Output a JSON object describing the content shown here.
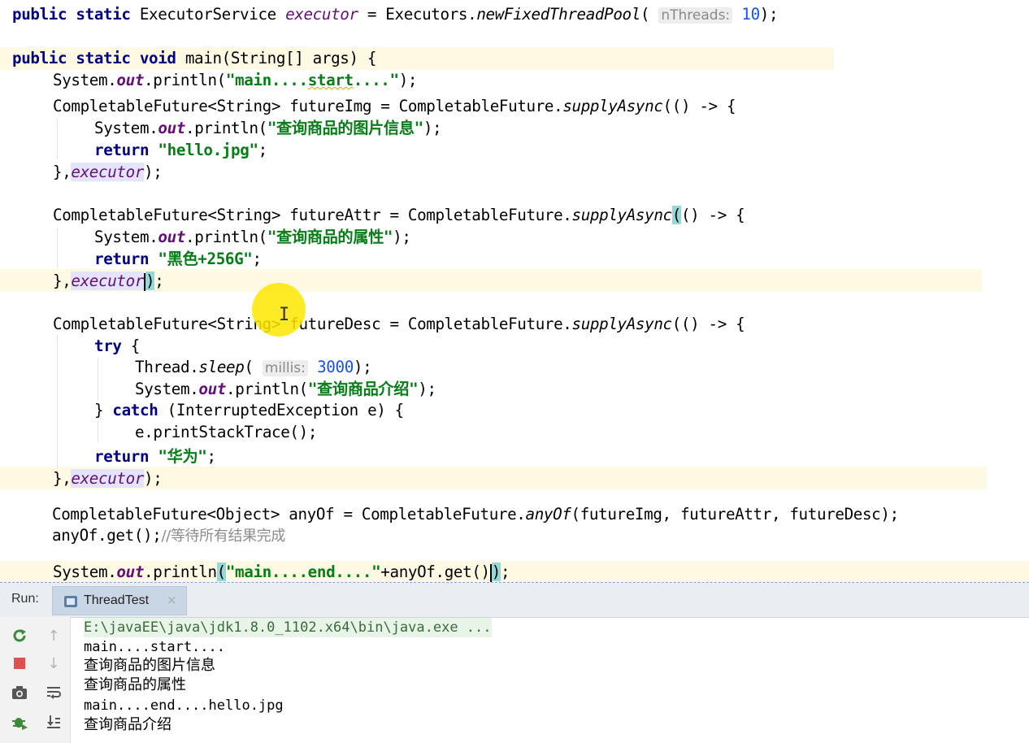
{
  "editor": {
    "line1": {
      "kw": "public static",
      "type": " ExecutorService ",
      "field": "executor",
      "eq": " = Executors.",
      "method": "newFixedThreadPool",
      "open": "( ",
      "hint": "nThreads:",
      "num": " 10",
      "close": ");"
    },
    "line_main": {
      "kw": "public static void",
      "rest": " main(String[] args) {"
    },
    "line_start": {
      "pre": "System.",
      "out": "out",
      "mid": ".println(",
      "str_open": "\"main....",
      "str_sq": "start",
      "str_close": "....\"",
      "close": ");"
    },
    "img_decl": {
      "pre": "CompletableFuture<String> futureImg = CompletableFuture.",
      "method": "supplyAsync",
      "post": "(() -> {"
    },
    "img_print": {
      "pre": "System.",
      "out": "out",
      "mid": ".println(",
      "str": "\"查询商品的图片信息\"",
      "close": ");"
    },
    "img_return": {
      "kw": "return",
      "str": " \"hello.jpg\"",
      "semi": ";"
    },
    "img_close": {
      "pre": "},",
      "field": "executor",
      "close": ");"
    },
    "attr_decl": {
      "pre": "CompletableFuture<String> futureAttr = CompletableFuture.",
      "method": "supplyAsync",
      "paren": "(",
      "post": "() -> {"
    },
    "attr_print": {
      "pre": "System.",
      "out": "out",
      "mid": ".println(",
      "str": "\"查询商品的属性\"",
      "close": ");"
    },
    "attr_return": {
      "kw": "return",
      "str": " \"黑色+256G\"",
      "semi": ";"
    },
    "attr_close": {
      "pre": "},",
      "field": "executo",
      "field2": "r",
      "paren": ")",
      "close": ";"
    },
    "desc_decl": {
      "pre": "CompletableFuture<String> futureDesc = CompletableFuture.",
      "method": "supplyAsync",
      "post": "(() -> {"
    },
    "desc_try": {
      "kw": "try",
      "post": " {"
    },
    "desc_sleep": {
      "pre": "Thread.",
      "method": "sleep",
      "open": "( ",
      "hint": "millis:",
      "num": " 3000",
      "close": ");"
    },
    "desc_print": {
      "pre": "System.",
      "out": "out",
      "mid": ".println(",
      "str": "\"查询商品介绍\"",
      "close": ");"
    },
    "desc_catch": {
      "pre": "} ",
      "kw": "catch",
      "post": " (InterruptedException e) {"
    },
    "desc_trace": {
      "text": "e.printStackTrace();"
    },
    "desc_close_catch": {
      "text": "}"
    },
    "desc_return": {
      "kw": "return",
      "str": " \"华为\"",
      "semi": ";"
    },
    "desc_close": {
      "pre": "},",
      "field": "executor",
      "close": ");"
    },
    "anyof_decl": {
      "pre": "CompletableFuture<Object> anyOf = CompletableFuture.",
      "method": "anyOf",
      "post": "(futureImg, futureAttr, futureDesc);"
    },
    "anyof_get": {
      "text": "anyOf.get();",
      "comment": "//等待所有结果完成"
    },
    "line_end": {
      "pre": "System.",
      "out": "out",
      "mid": ".println",
      "paren": "(",
      "str": "\"main....end....\"",
      "post": "+anyOf.get()",
      "paren2": ")",
      "close": ";"
    }
  },
  "run_panel": {
    "label": "Run:",
    "tab_label": "ThreadTest",
    "tab_close": "×",
    "console": [
      "E:\\javaEE\\java\\jdk1.8.0_1102.x64\\bin\\java.exe ...",
      "main....start....",
      "查询商品的图片信息",
      "查询商品的属性",
      "main....end....hello.jpg",
      "查询商品介绍"
    ]
  },
  "colors": {
    "accent_run_green": "#3a8a3a",
    "stop_red": "#d9534f",
    "keyword": "#000080",
    "string": "#067d17"
  }
}
